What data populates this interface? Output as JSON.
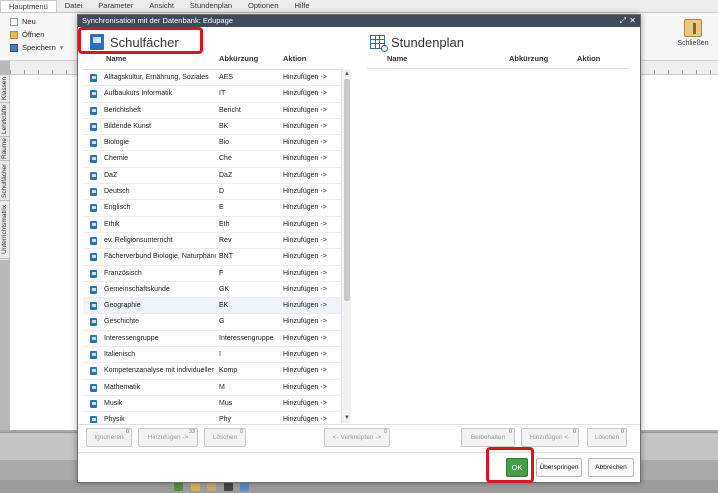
{
  "menu": [
    "Hauptmenü",
    "Datei",
    "Parameter",
    "Ansicht",
    "Stundenplan",
    "Optionen",
    "Hilfe"
  ],
  "ribbon": {
    "new": "Neu",
    "open": "Öffnen",
    "save": "Speichern",
    "close": "Schließen"
  },
  "vtabs": [
    "Klassen",
    "Lehrkräfte",
    "Räume",
    "Schulfächer",
    "Unterrichtsmatrix"
  ],
  "dialog": {
    "title": "Synchronisation mit der Datenbank: Edupage",
    "left": {
      "title": "Schulfächer",
      "headers": {
        "name": "Name",
        "abbr": "Abkürzung",
        "action": "Aktion"
      },
      "rows": [
        {
          "name": "Alltagskultur, Ernährung, Soziales",
          "abbr": "AES",
          "action": "Hinzufügen ->"
        },
        {
          "name": "Aufbaukurs Informatik",
          "abbr": "IT",
          "action": "Hinzufügen ->"
        },
        {
          "name": "Berichtsheft",
          "abbr": "Bericht",
          "action": "Hinzufügen ->"
        },
        {
          "name": "Bildende Kunst",
          "abbr": "BK",
          "action": "Hinzufügen ->"
        },
        {
          "name": "Biologie",
          "abbr": "Bio",
          "action": "Hinzufügen ->"
        },
        {
          "name": "Chemie",
          "abbr": "Che",
          "action": "Hinzufügen ->"
        },
        {
          "name": "DaZ",
          "abbr": "DaZ",
          "action": "Hinzufügen ->"
        },
        {
          "name": "Deutsch",
          "abbr": "D",
          "action": "Hinzufügen ->"
        },
        {
          "name": "Englisch",
          "abbr": "E",
          "action": "Hinzufügen ->"
        },
        {
          "name": "Ethik",
          "abbr": "Eth",
          "action": "Hinzufügen ->"
        },
        {
          "name": "ev. Religionsunterricht",
          "abbr": "Rev",
          "action": "Hinzufügen ->"
        },
        {
          "name": "Fächerverbund Biologie, Naturphänomene",
          "abbr": "BNT",
          "action": "Hinzufügen ->"
        },
        {
          "name": "Französisch",
          "abbr": "F",
          "action": "Hinzufügen ->"
        },
        {
          "name": "Gemeinschaftskunde",
          "abbr": "GK",
          "action": "Hinzufügen ->"
        },
        {
          "name": "Geographie",
          "abbr": "EK",
          "action": "Hinzufügen ->"
        },
        {
          "name": "Geschichte",
          "abbr": "G",
          "action": "Hinzufügen ->"
        },
        {
          "name": "Interessengruppe",
          "abbr": "Interessengruppe",
          "action": "Hinzufügen ->"
        },
        {
          "name": "Italienisch",
          "abbr": "I",
          "action": "Hinzufügen ->"
        },
        {
          "name": "Kompetenzanalyse mit individueller Förderung",
          "abbr": "Komp",
          "action": "Hinzufügen ->"
        },
        {
          "name": "Mathematik",
          "abbr": "M",
          "action": "Hinzufügen ->"
        },
        {
          "name": "Musik",
          "abbr": "Mus",
          "action": "Hinzufügen ->"
        },
        {
          "name": "Physik",
          "abbr": "Phy",
          "action": "Hinzufügen ->"
        }
      ]
    },
    "right": {
      "title": "Stundenplan",
      "headers": {
        "name": "Name",
        "abbr": "Abkürzung",
        "action": "Aktion"
      }
    },
    "buttons": {
      "ignore": {
        "label": "Ignorieren",
        "count": "0"
      },
      "add": {
        "label": "Hinzufügen ->",
        "count": "33"
      },
      "delete_left": {
        "label": "Löschen",
        "count": "0"
      },
      "link": {
        "label": "<- Verknüpfen ->",
        "count": "0"
      },
      "keep": {
        "label": "Beibehalten",
        "count": "0"
      },
      "add_left": {
        "label": "Hinzufügen <-",
        "count": "0"
      },
      "delete_right": {
        "label": "Löschen",
        "count": "0"
      },
      "ok": "OK",
      "skip": "Überspringen",
      "cancel": "Abbrechen"
    }
  },
  "colors": {
    "ok_green": "#43a047",
    "highlight_red": "#e3111b",
    "titlebar": "#3f4a5a",
    "icon_blue": "#2f6fb8"
  }
}
